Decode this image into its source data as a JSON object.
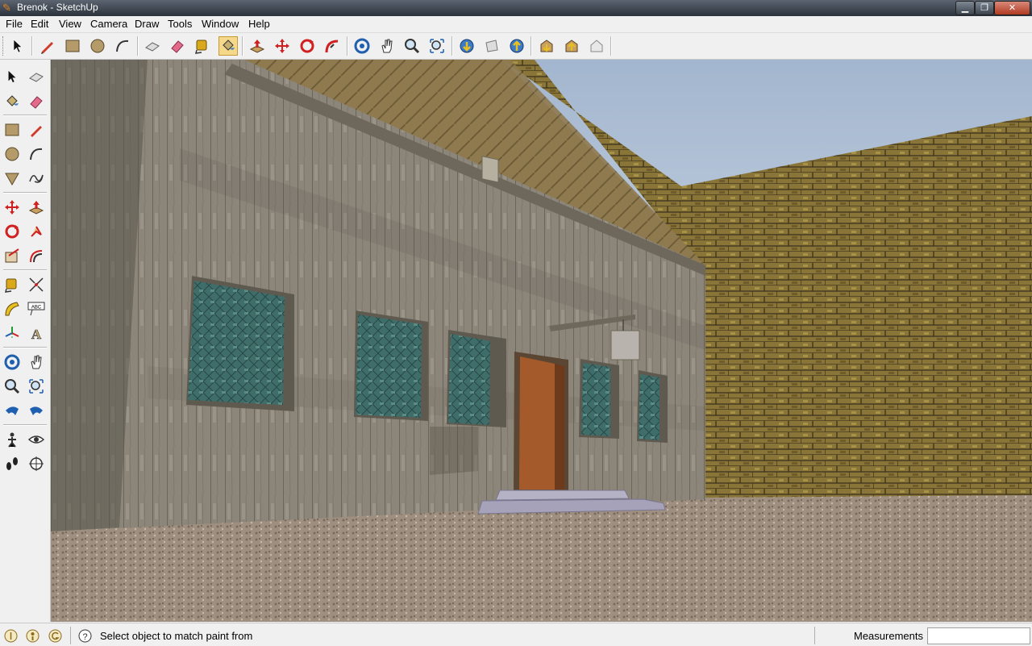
{
  "window": {
    "title": "Brenok - SketchUp",
    "controls": [
      "minimize-icon",
      "maximize-icon",
      "close-icon"
    ]
  },
  "menu": [
    "File",
    "Edit",
    "View",
    "Camera",
    "Draw",
    "Tools",
    "Window",
    "Help"
  ],
  "toolbar": {
    "tools": [
      "select",
      "pencil",
      "rectangle",
      "circle",
      "arc",
      "make-component",
      "eraser",
      "tape-measure",
      "paint-bucket",
      "push-pull",
      "move",
      "rotate",
      "follow-me",
      "orbit",
      "pan",
      "zoom",
      "zoom-extents",
      "get-models",
      "share-model",
      "share-component",
      "get-photo-texture",
      "place-model",
      "preview-google-earth"
    ],
    "active_tool": "paint-bucket"
  },
  "sidebar": {
    "tools": [
      "select",
      "make-component",
      "paint-bucket",
      "eraser",
      "rectangle",
      "line",
      "circle",
      "arc",
      "polygon",
      "freehand",
      "move",
      "push-pull",
      "rotate",
      "follow-me",
      "scale",
      "offset",
      "tape-measure",
      "dimension",
      "protractor",
      "text",
      "axes",
      "3d-text",
      "orbit",
      "pan",
      "zoom",
      "zoom-extents",
      "previous",
      "next",
      "position-camera",
      "look-around",
      "walk",
      "section-plane"
    ]
  },
  "status": {
    "message": "Select object to match paint from",
    "measurements_label": "Measurements",
    "measurements_value": "",
    "icons": [
      "geo-location-icon",
      "credits-icon",
      "user-icon",
      "help-icon"
    ]
  },
  "colors": {
    "sky": "#a9bcd6",
    "brick": "#8a7538",
    "wood": "#8c867a",
    "ground": "#9e8f80",
    "door": "#a55a2c",
    "window_glass": "#3f6e6a",
    "active_tool_bg": "#f5d88a"
  }
}
